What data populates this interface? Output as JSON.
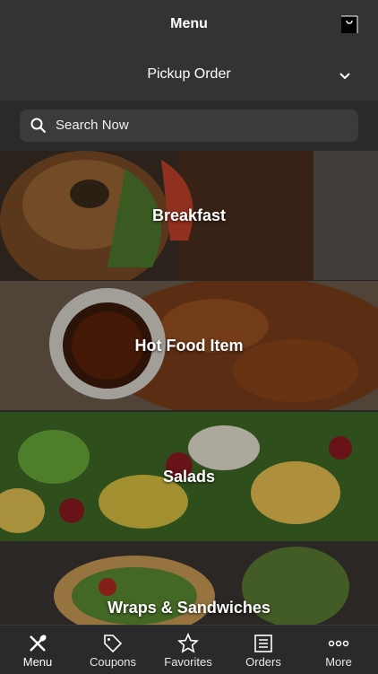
{
  "header": {
    "title": "Menu",
    "order_type": "Pickup Order"
  },
  "search": {
    "placeholder": "Search Now"
  },
  "categories": [
    {
      "label": "Breakfast",
      "icon": "bagel-image"
    },
    {
      "label": "Hot Food Item",
      "icon": "hot-food-image"
    },
    {
      "label": "Salads",
      "icon": "salad-image"
    },
    {
      "label": "Wraps & Sandwiches",
      "icon": "wrap-image"
    }
  ],
  "tabs": [
    {
      "label": "Menu",
      "icon": "utensils-icon",
      "active": true
    },
    {
      "label": "Coupons",
      "icon": "tag-icon"
    },
    {
      "label": "Favorites",
      "icon": "star-icon"
    },
    {
      "label": "Orders",
      "icon": "list-icon"
    },
    {
      "label": "More",
      "icon": "more-icon"
    }
  ],
  "colors": {
    "header_bg": "#333333",
    "search_bg": "#3b3b3b",
    "tabbar_bg": "#2a2a2a"
  }
}
